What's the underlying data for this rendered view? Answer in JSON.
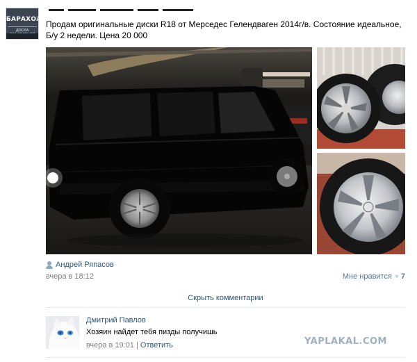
{
  "group": {
    "avatar_line1": "БАРАХОЛКА",
    "avatar_line2": "ДОСКА ОБЪЯВЛЕНИЙ"
  },
  "post": {
    "text": "Продам оригинальные диски R18 от Мерседес Гелендваген 2014г/в. Состояние идеальное, Б/у 2 недели. Цена 20 000",
    "author": "Андрей Ряпасов",
    "date": "вчера в 18:12",
    "like_label": "Мне нравится",
    "like_count": "7",
    "hide_comments_label": "Скрыть комментарии"
  },
  "comment": {
    "author": "Дмитрий Павлов",
    "text": "Хозяин найдет тебя пизды получишь",
    "date": "вчера в 19:01",
    "separator": "|",
    "reply_label": "Ответить"
  },
  "watermark": "YAPLAKAL.COM",
  "icons": {
    "author": "person-icon",
    "like": "heart-icon"
  },
  "colors": {
    "link": "#2b587a",
    "muted": "#7f7f7f",
    "like": "#5d7896",
    "watermark": "#9fb0c2"
  }
}
